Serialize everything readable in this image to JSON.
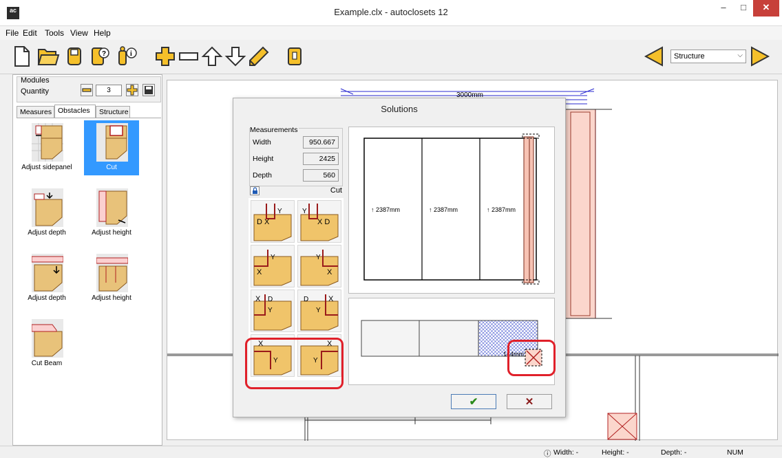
{
  "window": {
    "title": "Example.clx - autoclosets 12",
    "app_icon_text": "ac",
    "min_glyph": "–",
    "max_glyph": "□",
    "close_glyph": "✕"
  },
  "menu": [
    "File",
    "Edit",
    "Tools",
    "View",
    "Help"
  ],
  "toolbar": {
    "icons": [
      "new-file-icon",
      "open-folder-icon",
      "save-icon",
      "help-icon",
      "info-icon",
      "add-icon",
      "remove-icon",
      "arrow-up-icon",
      "arrow-down-icon",
      "pencil-icon",
      "door-icon"
    ],
    "view_select": "Structure",
    "accent": "#f5c02a"
  },
  "modules": {
    "legend": "Modules",
    "quantity_label": "Quantity",
    "quantity_value": "3"
  },
  "tabs": [
    "Measures",
    "Obstacles",
    "Structure"
  ],
  "obstacles": [
    {
      "label": "Adjust sidepanel",
      "selected": false
    },
    {
      "label": "Cut",
      "selected": true
    },
    {
      "label": "Adjust depth",
      "selected": false
    },
    {
      "label": "Adjust height",
      "selected": false
    },
    {
      "label": "Adjust depth",
      "selected": false
    },
    {
      "label": "Adjust height",
      "selected": false
    },
    {
      "label": "Cut Beam",
      "selected": false
    }
  ],
  "canvas": {
    "dimension_top": "3000mm"
  },
  "dialog": {
    "title": "Solutions",
    "measurements": {
      "legend": "Measurements",
      "rows": [
        {
          "label": "Width",
          "value": "950.667"
        },
        {
          "label": "Height",
          "value": "2425"
        },
        {
          "label": "Depth",
          "value": "560"
        }
      ]
    },
    "cut_label": "Cut",
    "preview": {
      "heights": [
        "↑ 2387mm",
        "↑ 2387mm",
        "↑ 2387mm"
      ],
      "bottom_label": "144mm"
    },
    "ok_glyph": "✔",
    "cancel_glyph": "✕"
  },
  "status": {
    "width": "Width: -",
    "height": "Height: -",
    "depth": "Depth: -",
    "num": "NUM"
  }
}
